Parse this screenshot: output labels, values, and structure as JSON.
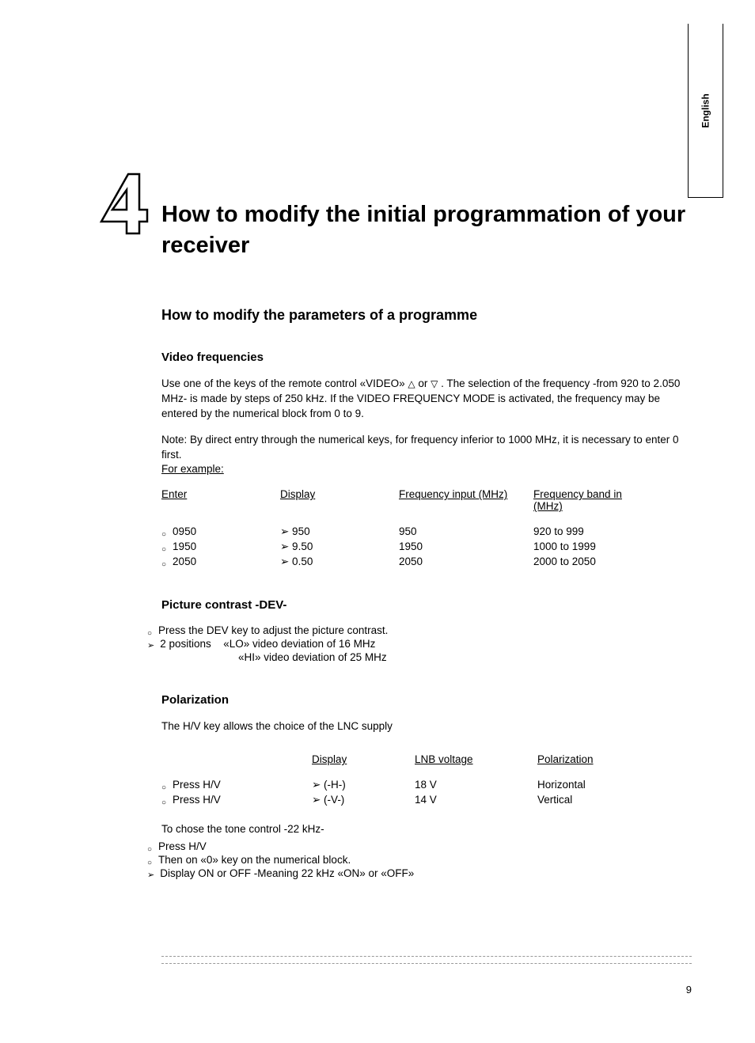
{
  "language_tab": "English",
  "chapter_number": "4",
  "main_title": "How to modify the initial programmation of your receiver",
  "section_title": "How to modify the parameters of a programme",
  "video_freq": {
    "title": "Video frequencies",
    "para1_a": "Use one of the keys of the remote control «VIDEO» ",
    "para1_b": " or ",
    "para1_c": " . The selection of the frequency -from 920 to 2.050 MHz- is made by steps of 250 kHz. If the VIDEO FREQUENCY MODE is activated, the frequency may be entered by the numerical block from 0 to 9.",
    "para2": "Note: By direct entry through the numerical keys, for frequency inferior to 1000 MHz, it is necessary to enter 0 first.",
    "para2_link": "For example:",
    "headers": {
      "enter": "Enter",
      "display": "Display",
      "freq_input": "Frequency input",
      "freq_input_unit": " (MHz)",
      "freq_band": "Frequency band in",
      "freq_band_unit": "(MHz)"
    },
    "rows": [
      {
        "enter": "0950",
        "display": "➢ 950",
        "freq": "950",
        "band": "920 to 999"
      },
      {
        "enter": "1950",
        "display": "➢ 9.50",
        "freq": "1950",
        "band": "1000 to 1999"
      },
      {
        "enter": "2050",
        "display": "➢ 0.50",
        "freq": "2050",
        "band": "2000 to 2050"
      }
    ]
  },
  "picture_contrast": {
    "title": "Picture contrast -DEV-",
    "line1": "Press the DEV key to adjust the picture contrast.",
    "line2_a": "2 positions",
    "line2_b": "«LO» video deviation of 16 MHz",
    "line3": "«HI»  video deviation of 25 MHz"
  },
  "polarization": {
    "title": "Polarization",
    "para": "The H/V key allows the choice of the LNC supply",
    "headers": {
      "display": "Display",
      "lnb": "LNB voltage",
      "pol": "Polarization"
    },
    "rows": [
      {
        "action": "Press H/V",
        "display": "➢ (-H-)",
        "voltage": "18 V",
        "pol": "Horizontal"
      },
      {
        "action": "Press H/V",
        "display": "➢ (-V-)",
        "voltage": "14 V",
        "pol": "Vertical"
      }
    ],
    "tone_para": "To chose the tone control -22 kHz-",
    "tone_b1": "Press H/V",
    "tone_b2": "Then on «0» key on the numerical block.",
    "tone_b3": "Display ON or OFF -Meaning 22 kHz «ON» or «OFF»"
  },
  "page_number": "9"
}
